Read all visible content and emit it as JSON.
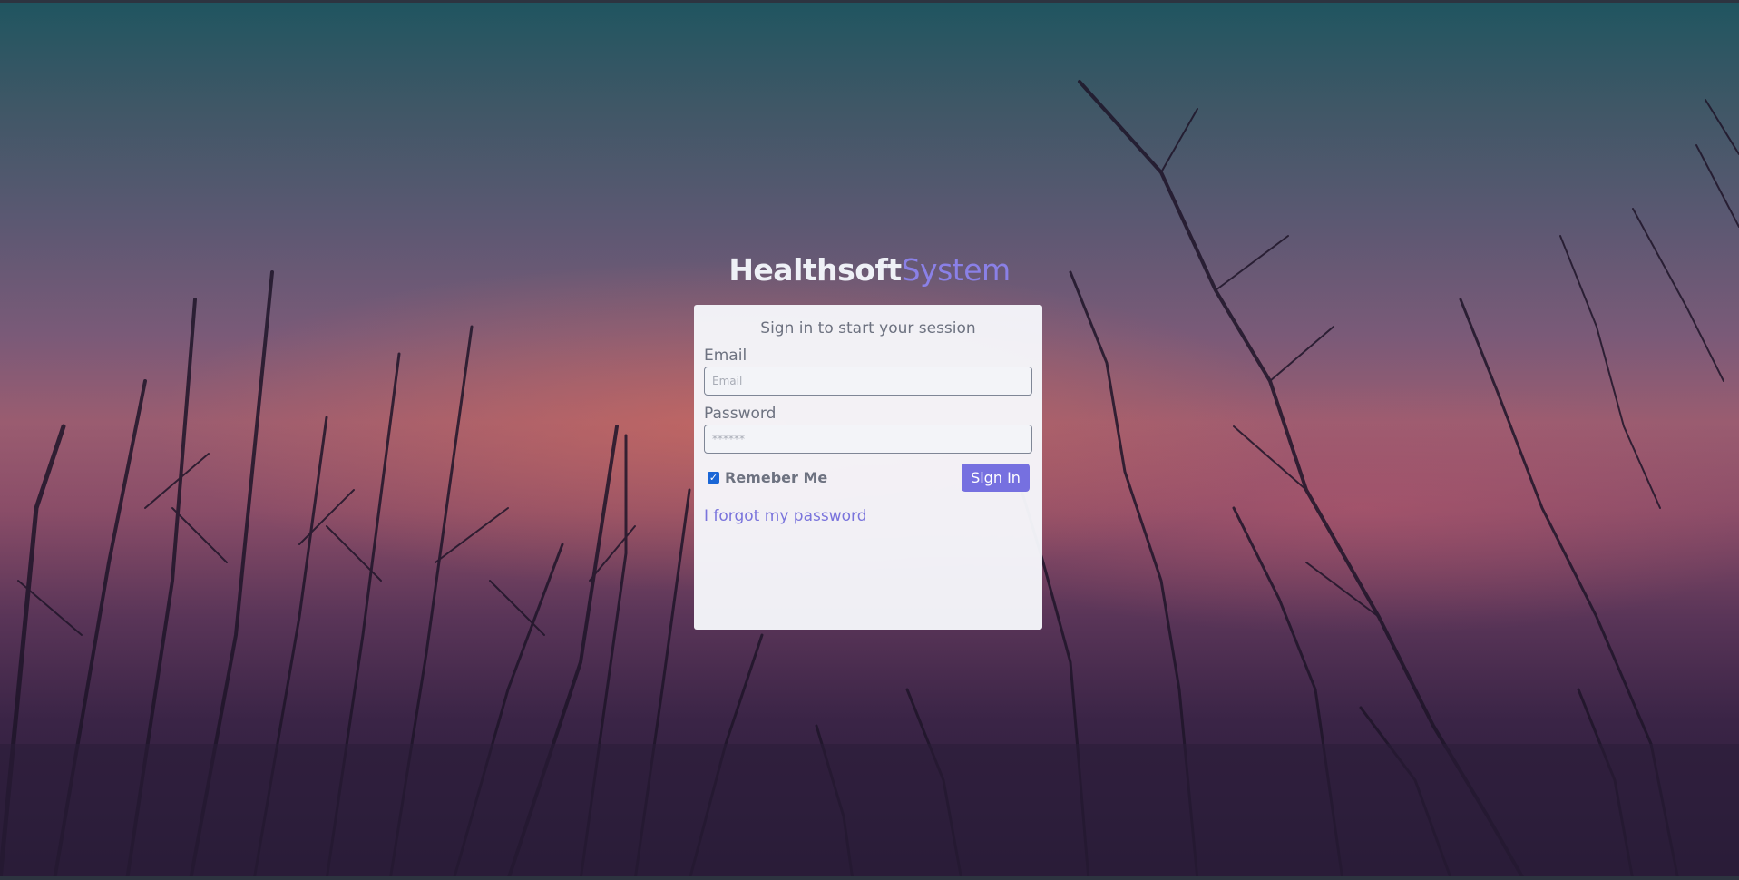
{
  "logo": {
    "brand": "Healthsoft",
    "suffix": "System"
  },
  "login": {
    "message": "Sign in to start your session",
    "email_label": "Email",
    "email_placeholder": "Email",
    "password_label": "Password",
    "password_placeholder": "******",
    "remember_label": "Remeber Me",
    "remember_checked": true,
    "signin_label": "Sign In",
    "forgot_link": "I forgot my password"
  },
  "colors": {
    "accent": "#7670e0",
    "link": "#7a74dc",
    "checkbox": "#1a66d6"
  }
}
